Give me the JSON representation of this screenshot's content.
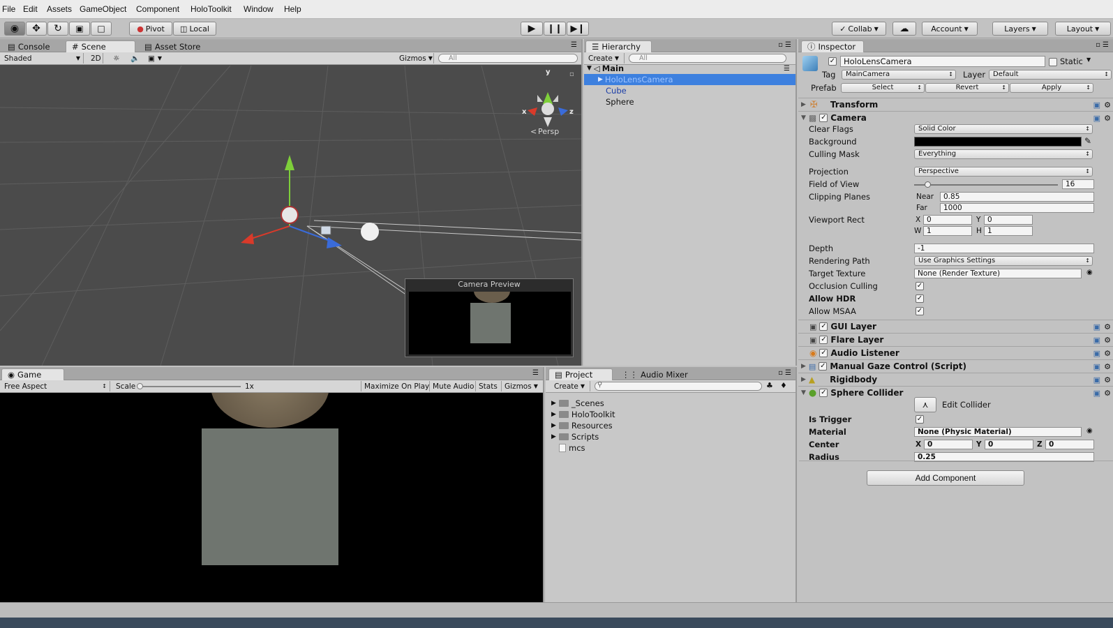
{
  "menu": [
    "File",
    "Edit",
    "Assets",
    "GameObject",
    "Component",
    "HoloToolkit",
    "Window",
    "Help"
  ],
  "toolbar": {
    "pivot": "Pivot",
    "local": "Local",
    "collab": "Collab",
    "account": "Account",
    "layers": "Layers",
    "layout": "Layout"
  },
  "scene": {
    "tabs": [
      "Console",
      "Scene",
      "Asset Store"
    ],
    "shading": "Shaded",
    "mode2d": "2D",
    "gizmos": "Gizmos",
    "search_placeholder": "All",
    "persp": "Persp",
    "axis_x": "x",
    "axis_y": "y",
    "axis_z": "z",
    "camera_preview": "Camera Preview"
  },
  "game": {
    "tab": "Game",
    "aspect": "Free Aspect",
    "scale_label": "Scale",
    "scale_value": "1x",
    "maximize": "Maximize On Play",
    "mute": "Mute Audio",
    "stats": "Stats",
    "gizmos": "Gizmos"
  },
  "hierarchy": {
    "tab": "Hierarchy",
    "create": "Create",
    "search_placeholder": "All",
    "scene": "Main",
    "items": [
      "HoloLensCamera",
      "Cube",
      "Sphere"
    ]
  },
  "project": {
    "tabs": [
      "Project",
      "Audio Mixer"
    ],
    "create": "Create",
    "items": [
      "_Scenes",
      "HoloToolkit",
      "Resources",
      "Scripts",
      "mcs"
    ]
  },
  "inspector": {
    "tab": "Inspector",
    "object_name": "HoloLensCamera",
    "static": "Static",
    "tag_label": "Tag",
    "tag": "MainCamera",
    "layer_label": "Layer",
    "layer": "Default",
    "prefab_label": "Prefab",
    "prefab_buttons": [
      "Select",
      "Revert",
      "Apply"
    ],
    "components": {
      "transform": "Transform",
      "camera": "Camera",
      "gui_layer": "GUI Layer",
      "flare_layer": "Flare Layer",
      "audio_listener": "Audio Listener",
      "gaze": "Manual Gaze Control (Script)",
      "rigidbody": "Rigidbody",
      "sphere_collider": "Sphere Collider"
    },
    "camera": {
      "clear_flags_label": "Clear Flags",
      "clear_flags": "Solid Color",
      "background_label": "Background",
      "background_color": "#000000",
      "culling_mask_label": "Culling Mask",
      "culling_mask": "Everything",
      "projection_label": "Projection",
      "projection": "Perspective",
      "fov_label": "Field of View",
      "fov": "16",
      "clipping_label": "Clipping Planes",
      "near_label": "Near",
      "near": "0.85",
      "far_label": "Far",
      "far": "1000",
      "viewport_label": "Viewport Rect",
      "vx_label": "X",
      "vx": "0",
      "vy_label": "Y",
      "vy": "0",
      "vw_label": "W",
      "vw": "1",
      "vh_label": "H",
      "vh": "1",
      "depth_label": "Depth",
      "depth": "-1",
      "rendering_path_label": "Rendering Path",
      "rendering_path": "Use Graphics Settings",
      "target_texture_label": "Target Texture",
      "target_texture": "None (Render Texture)",
      "occlusion_label": "Occlusion Culling",
      "hdr_label": "Allow HDR",
      "msaa_label": "Allow MSAA"
    },
    "collider": {
      "edit_label": "Edit Collider",
      "trigger_label": "Is Trigger",
      "material_label": "Material",
      "material": "None (Physic Material)",
      "center_label": "Center",
      "cx_label": "X",
      "cx": "0",
      "cy_label": "Y",
      "cy": "0",
      "cz_label": "Z",
      "cz": "0",
      "radius_label": "Radius",
      "radius": "0.25"
    },
    "add_component": "Add Component"
  },
  "colors": {
    "selection": "#3d80df",
    "scene_bg": "#4b4b4b",
    "panel": "#c2c2c2"
  }
}
